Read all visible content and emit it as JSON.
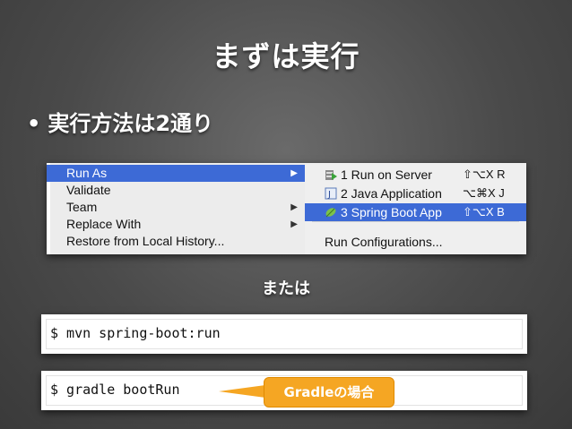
{
  "slide": {
    "title": "まずは実行",
    "bullet": "実行方法は2通り",
    "or_label": "または",
    "callout": "Gradleの場合"
  },
  "menu": {
    "items": [
      {
        "label": "Run As",
        "has_submenu": true,
        "selected": true
      },
      {
        "label": "Validate",
        "has_submenu": false
      },
      {
        "label": "Team",
        "has_submenu": true
      },
      {
        "label": "Replace With",
        "has_submenu": true
      },
      {
        "label": "Restore from Local History...",
        "has_submenu": false
      }
    ],
    "submenu": [
      {
        "label": "1 Run on Server",
        "shortcut": "⇧⌥X R",
        "icon": "run-server-icon"
      },
      {
        "label": "2 Java Application",
        "shortcut": "⌥⌘X J",
        "icon": "java-app-icon"
      },
      {
        "label": "3 Spring Boot App",
        "shortcut": "⇧⌥X B",
        "icon": "spring-leaf-icon",
        "selected": true
      },
      {
        "label": "Run Configurations...",
        "shortcut": ""
      }
    ],
    "selection_color": "#3d6ad6"
  },
  "commands": {
    "maven": "$ mvn spring-boot:run",
    "gradle": "$ gradle bootRun"
  }
}
